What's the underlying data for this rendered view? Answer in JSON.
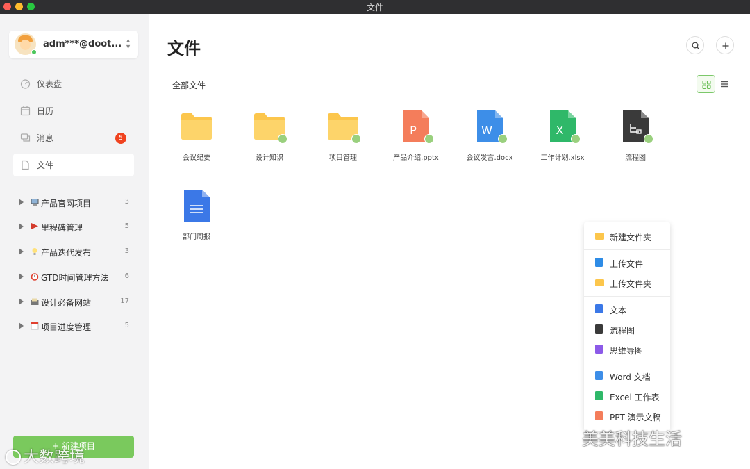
{
  "window": {
    "title": "文件"
  },
  "account": {
    "name": "adm***@doot..."
  },
  "nav": [
    {
      "label": "仪表盘",
      "icon": "dashboard-icon"
    },
    {
      "label": "日历",
      "icon": "calendar-icon"
    },
    {
      "label": "消息",
      "icon": "message-icon",
      "badge": "5"
    },
    {
      "label": "文件",
      "icon": "file-icon",
      "active": true
    }
  ],
  "projects": [
    {
      "name": "产品官网项目",
      "count": "3",
      "emoji": "computer-icon"
    },
    {
      "name": "里程碑管理",
      "count": "5",
      "emoji": "flag-icon"
    },
    {
      "name": "产品迭代发布",
      "count": "3",
      "emoji": "lightbulb-icon"
    },
    {
      "name": "GTD时间管理方法",
      "count": "6",
      "emoji": "alarm-clock-icon"
    },
    {
      "name": "设计必备网站",
      "count": "17",
      "emoji": "card-box-icon"
    },
    {
      "name": "项目进度管理",
      "count": "5",
      "emoji": "calendar-page-icon"
    }
  ],
  "new_project_label": "+ 新建项目",
  "main": {
    "title": "文件",
    "breadcrumb": "全部文件"
  },
  "files": [
    {
      "name": "会议纪要",
      "type": "folder",
      "shared": false
    },
    {
      "name": "设计知识",
      "type": "folder",
      "shared": true
    },
    {
      "name": "项目管理",
      "type": "folder",
      "shared": true
    },
    {
      "name": "产品介绍.pptx",
      "type": "ppt",
      "letter": "P",
      "shared": true
    },
    {
      "name": "会议发言.docx",
      "type": "word",
      "letter": "W",
      "shared": true
    },
    {
      "name": "工作计划.xlsx",
      "type": "excel",
      "letter": "X",
      "shared": true
    },
    {
      "name": "流程图",
      "type": "flowchart",
      "shared": true
    },
    {
      "name": "部门周报",
      "type": "doc",
      "shared": false
    }
  ],
  "context_menu": [
    {
      "label": "新建文件夹",
      "icon": "folder-icon"
    },
    {
      "label": "上传文件",
      "icon": "upload-file-icon"
    },
    {
      "label": "上传文件夹",
      "icon": "upload-folder-icon"
    },
    {
      "label": "文本",
      "icon": "text-doc-icon"
    },
    {
      "label": "流程图",
      "icon": "flowchart-icon"
    },
    {
      "label": "思维导图",
      "icon": "mindmap-icon"
    },
    {
      "label": "Word 文档",
      "icon": "word-icon"
    },
    {
      "label": "Excel 工作表",
      "icon": "excel-icon"
    },
    {
      "label": "PPT 演示文稿",
      "icon": "ppt-icon"
    }
  ],
  "colors": {
    "accent": "#7ac95d",
    "folder": "#fcc64c",
    "ppt": "#f47d5b",
    "word": "#3d8ee8",
    "excel": "#2fb869",
    "flowchart": "#3a3a3a",
    "doc": "#3b78e7",
    "mindmap": "#8c5ae8",
    "badge": "#f0431f"
  },
  "watermarks": {
    "left": "大数跨境",
    "right": "美美科技生活"
  }
}
